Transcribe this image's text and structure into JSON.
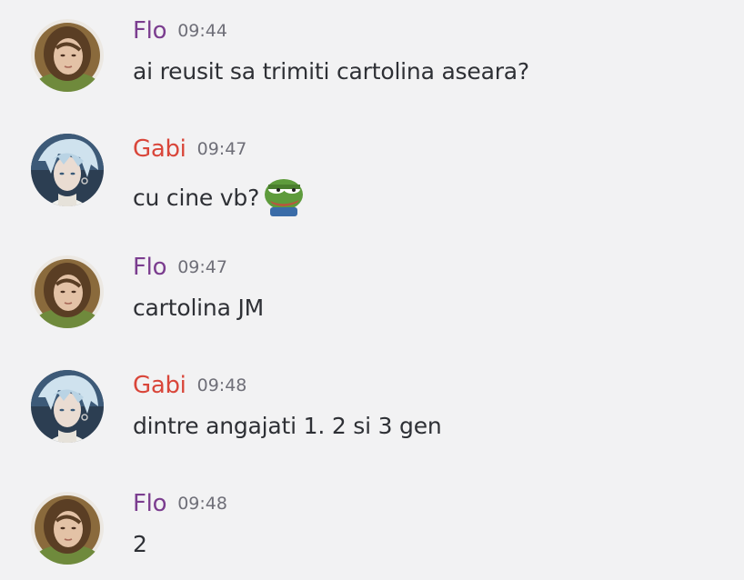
{
  "messages": [
    {
      "author": "Flo",
      "author_color": "#7b3d8f",
      "time": "09:44",
      "text": "ai reusit sa trimiti cartolina aseara?"
    },
    {
      "author": "Gabi",
      "author_color": "#d9463a",
      "time": "09:47",
      "text": "cu cine vb?",
      "emoji": "pepe-frog-emoji"
    },
    {
      "author": "Flo",
      "author_color": "#7b3d8f",
      "time": "09:47",
      "text": "cartolina JM"
    },
    {
      "author": "Gabi",
      "author_color": "#d9463a",
      "time": "09:48",
      "text": "dintre angajati 1. 2 si 3 gen"
    },
    {
      "author": "Flo",
      "author_color": "#7b3d8f",
      "time": "09:48",
      "text": "2"
    }
  ]
}
